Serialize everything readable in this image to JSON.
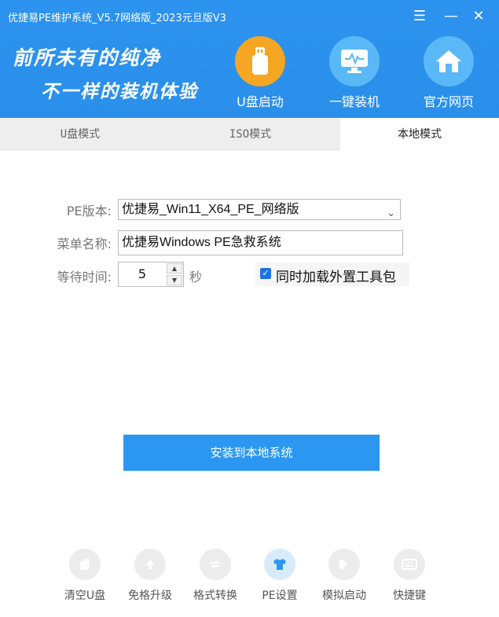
{
  "window": {
    "title": "优捷易PE维护系统_V5.7网络版_2023元旦版V3",
    "menu_icon": "menu-icon",
    "minimize_icon": "minimize-icon",
    "close_icon": "close-icon"
  },
  "banner": {
    "slogan_line1": "前所未有的纯净",
    "slogan_line2": "不一样的装机体验",
    "nav": [
      {
        "label": "U盘启动",
        "icon": "usb-drive-icon",
        "color": "#f5a623"
      },
      {
        "label": "一键装机",
        "icon": "monitor-pulse-icon",
        "color": "#5ab8f7"
      },
      {
        "label": "官方网页",
        "icon": "home-icon",
        "color": "#5ab8f7"
      }
    ]
  },
  "tabs": [
    {
      "label": "U盘模式"
    },
    {
      "label": "ISO模式"
    },
    {
      "label": "本地模式",
      "active": true
    }
  ],
  "form": {
    "pe_version_label": "PE版本:",
    "pe_version_value": "优捷易_Win11_X64_PE_网络版",
    "menu_name_label": "菜单名称:",
    "menu_name_value": "优捷易Windows PE急救系统",
    "wait_time_label": "等待时间:",
    "wait_time_value": "5",
    "wait_time_unit": "秒",
    "load_tools_label": "同时加载外置工具包",
    "load_tools_checked": true
  },
  "install_button": "安装到本地系统",
  "tools": [
    {
      "label": "清空U盘",
      "icon": "clear-usb-icon"
    },
    {
      "label": "免格升级",
      "icon": "upgrade-icon"
    },
    {
      "label": "格式转换",
      "icon": "convert-icon"
    },
    {
      "label": "PE设置",
      "icon": "shirt-icon",
      "active": true
    },
    {
      "label": "模拟启动",
      "icon": "play-icon"
    },
    {
      "label": "快捷键",
      "icon": "keyboard-icon"
    }
  ],
  "colors": {
    "accent": "#2b97f0",
    "header": "#2c93ee"
  }
}
